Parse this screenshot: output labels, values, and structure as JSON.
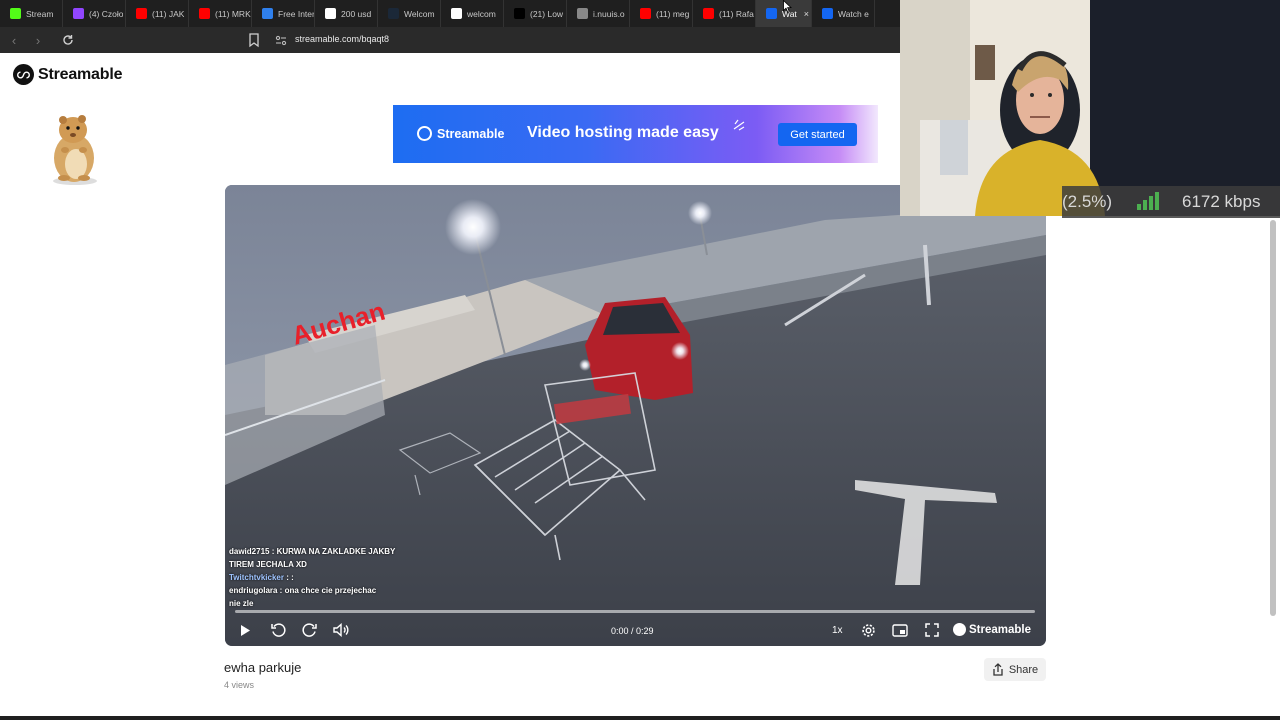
{
  "browser": {
    "tabs": [
      {
        "title": "Stream",
        "icon": "kick-icon",
        "color": "#53fc18"
      },
      {
        "title": "(4) Czoło",
        "icon": "twitch-icon",
        "color": "#9146ff"
      },
      {
        "title": "(11) JAK",
        "icon": "youtube-icon",
        "color": "#ff0000"
      },
      {
        "title": "(11) MRK",
        "icon": "youtube-icon",
        "color": "#ff0000"
      },
      {
        "title": "Free Inter",
        "icon": "doc-icon",
        "color": "#2f80ed"
      },
      {
        "title": "200 usd",
        "icon": "google-icon",
        "color": "#ffffff"
      },
      {
        "title": "Welcom",
        "icon": "steam-icon",
        "color": "#1b2838"
      },
      {
        "title": "welcom",
        "icon": "google-icon",
        "color": "#ffffff"
      },
      {
        "title": "(21) Low",
        "icon": "x-icon",
        "color": "#000000"
      },
      {
        "title": "i.nuuis.o",
        "icon": "globe-icon",
        "color": "#888888"
      },
      {
        "title": "(11) meg",
        "icon": "youtube-icon",
        "color": "#ff0000"
      },
      {
        "title": "(11) Rafa",
        "icon": "youtube-icon",
        "color": "#ff0000"
      },
      {
        "title": "Wat",
        "icon": "streamable-icon",
        "color": "#1466f1",
        "active": true
      },
      {
        "title": "Watch e",
        "icon": "streamable-icon",
        "color": "#1466f1"
      }
    ],
    "url": "streamable.com/bqaqt8"
  },
  "site": {
    "logo_text": "Streamable"
  },
  "banner": {
    "brand": "Streamable",
    "tagline": "Video hosting made easy",
    "cta": "Get started",
    "accent": "#1466f1"
  },
  "video": {
    "store_sign": "Auchan",
    "time": "0:00 / 0:29",
    "speed": "1x",
    "brand": "Streamable",
    "progress": 0.0,
    "chat": [
      {
        "user": "dawid2715",
        "text": "KURWA NA ZAKLADKE JAKBY"
      },
      {
        "user": "",
        "text": "TIREM JECHALA XD"
      },
      {
        "user": "Twitchtvkicker",
        "text": ":"
      },
      {
        "user": "endriugolara",
        "text": "ona chce cie przejechac"
      },
      {
        "user": "",
        "text": "nie zle"
      }
    ]
  },
  "meta": {
    "title": "ewha parkuje",
    "views": "4 views",
    "share_label": "Share"
  },
  "stream_stats": {
    "drop_pct": "(2.5%)",
    "bitrate": "6172 kbps",
    "signal_color": "#4caf50"
  }
}
